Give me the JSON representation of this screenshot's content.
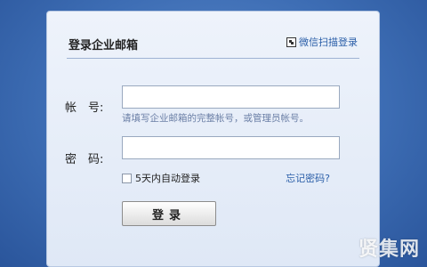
{
  "login": {
    "title": "登录企业邮箱",
    "wechat_login": "微信扫描登录",
    "account_label": "帐　号:",
    "account_value": "",
    "account_hint": "请填写企业邮箱的完整帐号，或管理员帐号。",
    "password_label": "密　码:",
    "password_value": "",
    "remember_label": "5天内自动登录",
    "remember_checked": false,
    "forgot_link": "忘记密码?",
    "submit_label": "登录"
  },
  "watermark": "贤集网",
  "colors": {
    "background": "#2f5fa6",
    "panel": "#e6edf8",
    "link": "#2a5ea8",
    "hint": "#6b7fa6"
  },
  "icons": {
    "wechat": "qr-code-icon"
  }
}
